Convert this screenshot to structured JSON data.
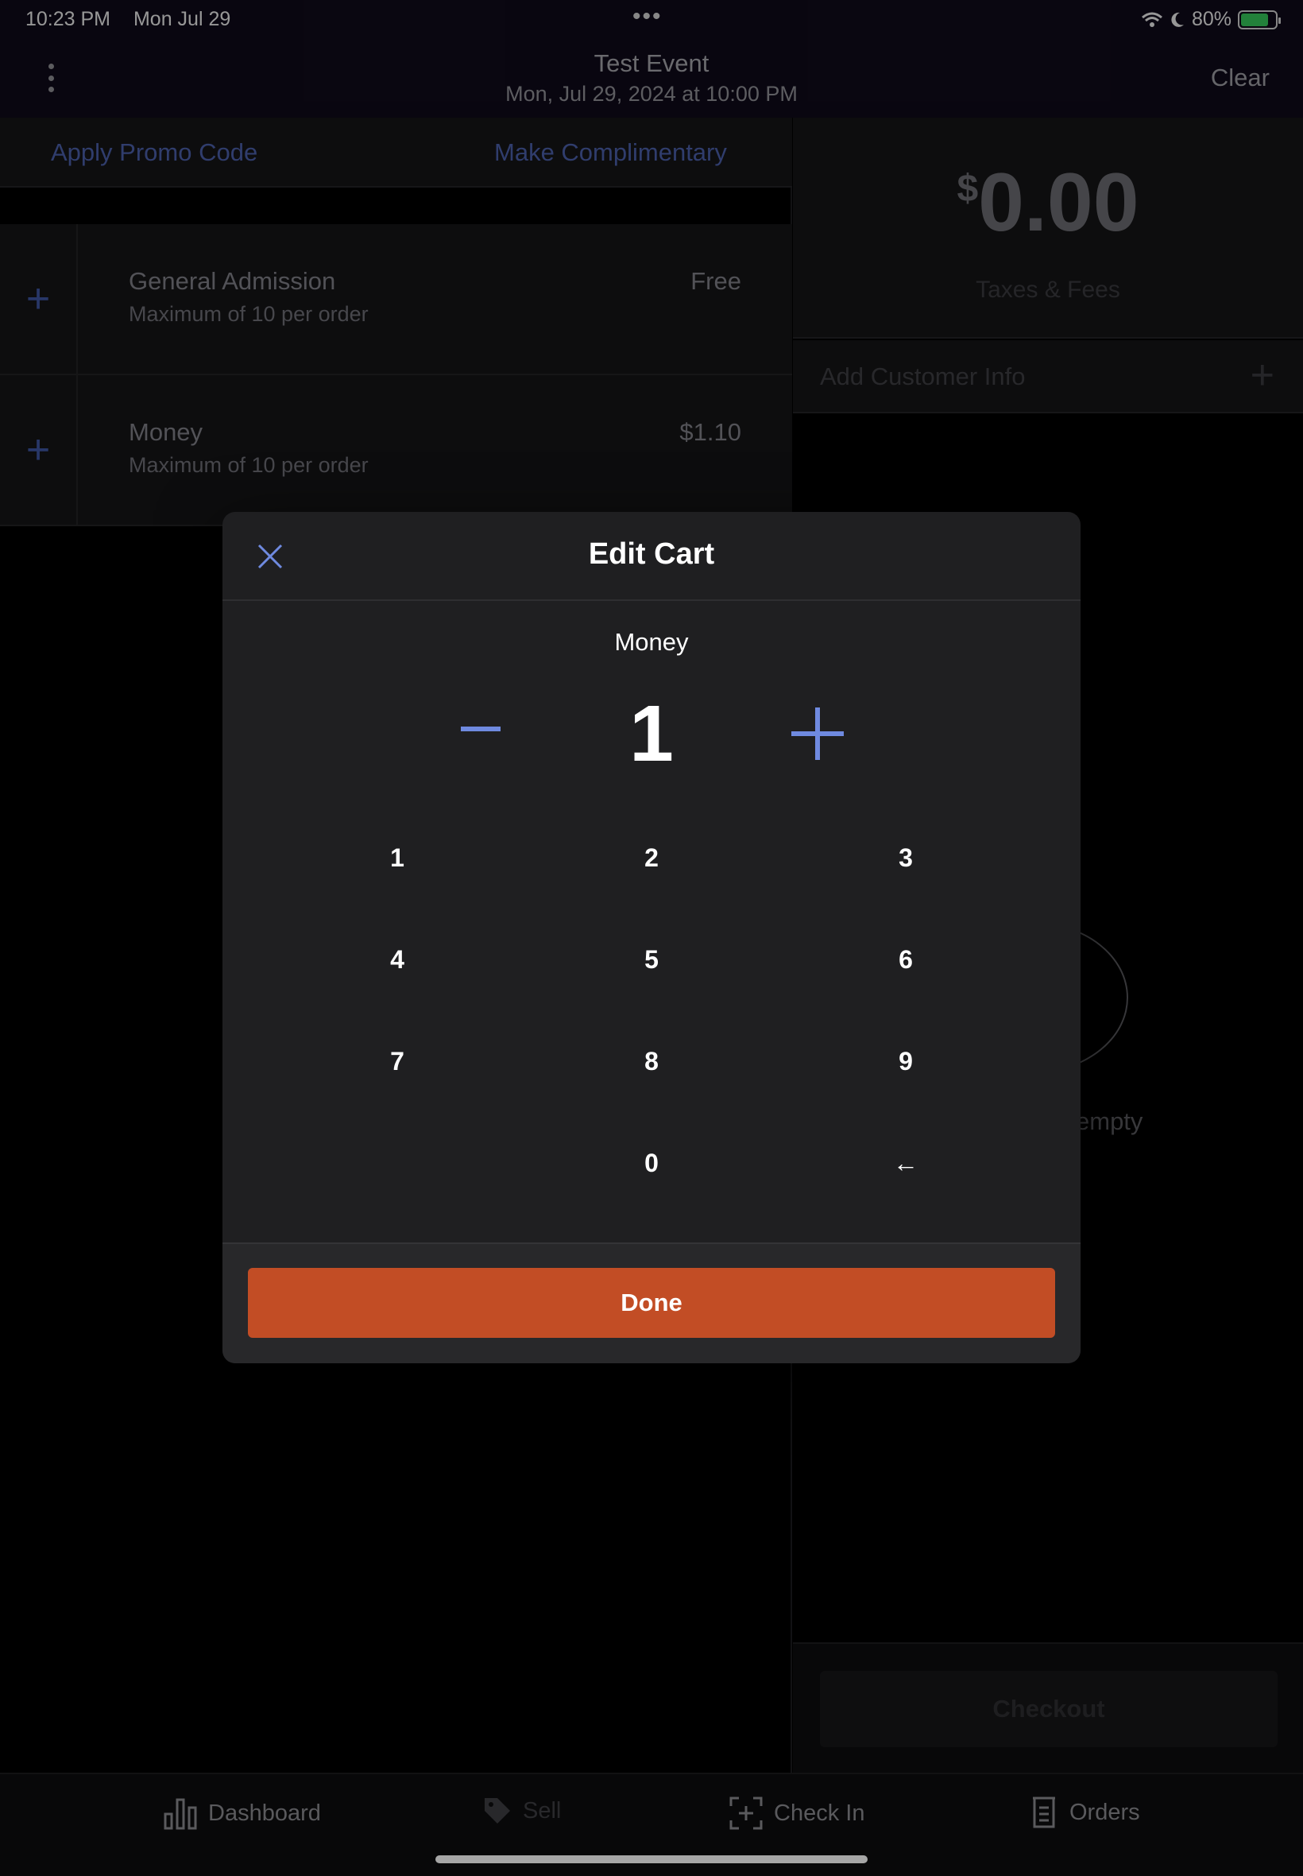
{
  "status_bar": {
    "time": "10:23 PM",
    "date": "Mon Jul 29",
    "dots": "•••",
    "battery_percent": "80%",
    "battery_level": 0.8
  },
  "header": {
    "event_title": "Test Event",
    "event_datetime": "Mon, Jul 29, 2024 at 10:00 PM",
    "clear_label": "Clear"
  },
  "actions": {
    "promo_label": "Apply Promo Code",
    "complimentary_label": "Make Complimentary"
  },
  "tickets": [
    {
      "name": "General Admission",
      "limit": "Maximum of 10 per order",
      "price": "Free",
      "add_icon": "+"
    },
    {
      "name": "Money",
      "limit": "Maximum of 10 per order",
      "price": "$1.10",
      "add_icon": "+"
    }
  ],
  "summary": {
    "currency": "$",
    "total": "0.00",
    "taxes_label": "Taxes & Fees",
    "customer_label": "Add Customer Info",
    "customer_plus": "+",
    "empty_partial": "empty",
    "checkout_label": "Checkout"
  },
  "tabs": [
    {
      "label": "Dashboard",
      "icon": "bar-chart-icon"
    },
    {
      "label": "Sell",
      "icon": "tag-icon"
    },
    {
      "label": "Check In",
      "icon": "scan-icon"
    },
    {
      "label": "Orders",
      "icon": "receipt-icon"
    }
  ],
  "modal": {
    "title": "Edit Cart",
    "item_name": "Money",
    "quantity": "1",
    "keys": [
      "1",
      "2",
      "3",
      "4",
      "5",
      "6",
      "7",
      "8",
      "9",
      "0",
      "←"
    ],
    "done_label": "Done"
  },
  "colors": {
    "accent_blue": "#6f8ae0",
    "done_orange": "#c24d25",
    "header_bg": "#0f0a1a",
    "panel_bg": "#141416",
    "modal_bg": "#1f1f21"
  }
}
